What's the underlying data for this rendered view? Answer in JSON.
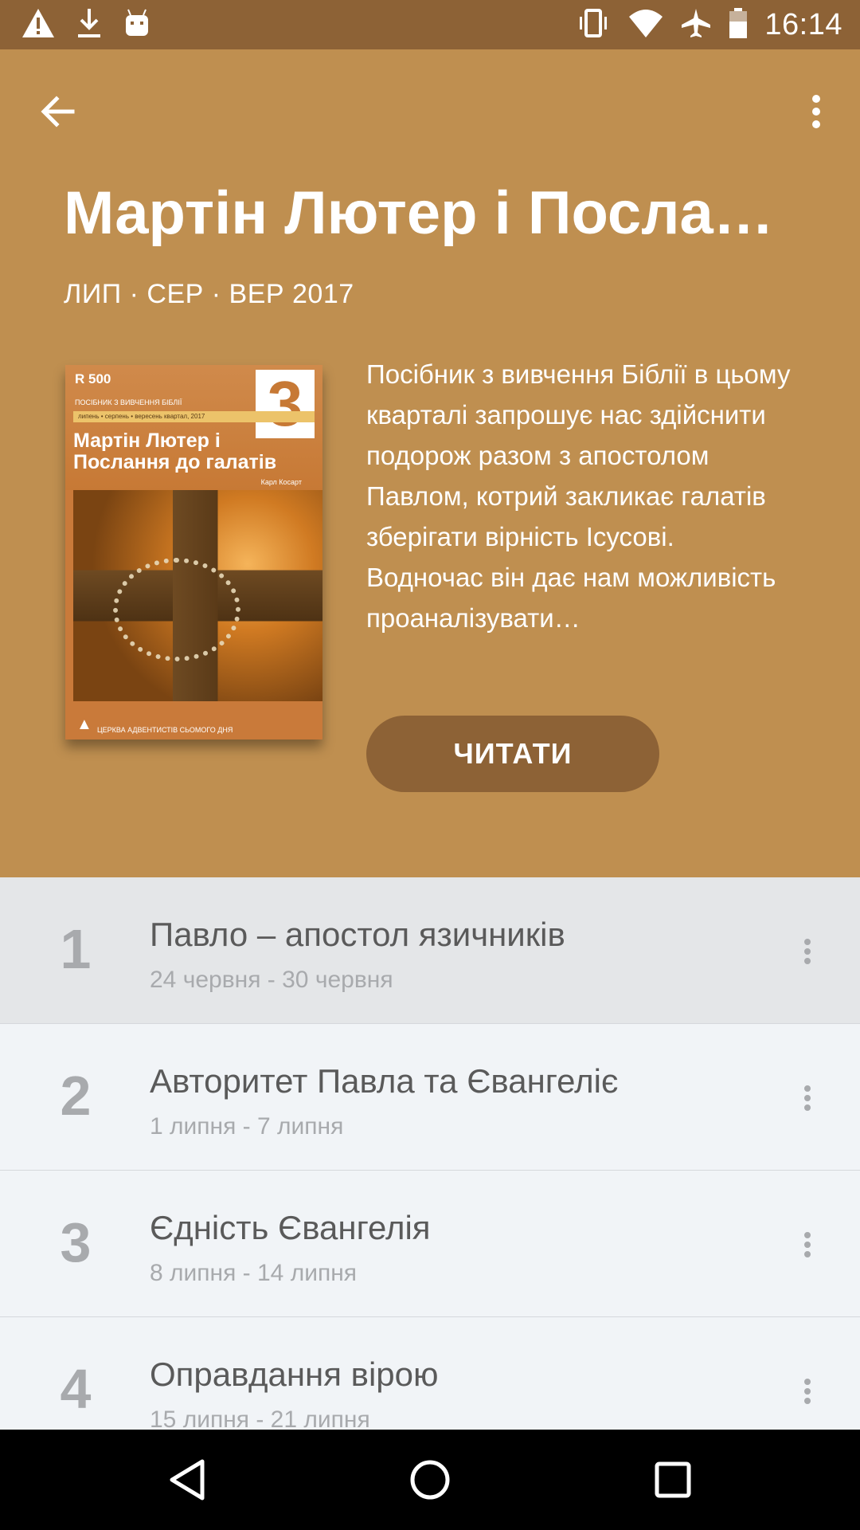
{
  "status_bar": {
    "time": "16:14",
    "left_icons": [
      "warning-icon",
      "download-icon",
      "android-icon"
    ],
    "right_icons": [
      "vibrate-icon",
      "wifi-icon",
      "airplane-icon",
      "battery-icon"
    ]
  },
  "header": {
    "title": "Мартін Лютер і Посла…",
    "subtitle": "ЛИП · СЕР · ВЕР 2017",
    "description": "Посібник з вивчення Біблії в цьому кварталі запрошує нас здійснити подорож разом з апостолом Павлом, котрий закликає галатів зберігати вірність Ісусові. Водночас він дає нам можливість проаналізувати…",
    "read_button": "ЧИТАТИ",
    "background": "#bf8f50",
    "accent": "#8d6236"
  },
  "cover": {
    "logo": "R 500",
    "quarter_digit": "3",
    "series_line": "ПОСІБНИК З ВИВЧЕННЯ БІБЛІЇ",
    "band_text": "липень • серпень • вересень                    квартал, 2017",
    "title": "Мартін Лютер і Послання до галатів",
    "author": "Карл Косарт",
    "footer": "ЦЕРКВА АДВЕНТИСТІВ СЬОМОГО ДНЯ"
  },
  "lessons": [
    {
      "num": "1",
      "title": "Павло – апостол язичників",
      "dates": "24 червня - 30 червня",
      "selected": true
    },
    {
      "num": "2",
      "title": "Авторитет Павла та Євангеліє",
      "dates": "1 липня - 7 липня",
      "selected": false
    },
    {
      "num": "3",
      "title": "Єдність Євангелія",
      "dates": "8 липня - 14 липня",
      "selected": false
    },
    {
      "num": "4",
      "title": "Оправдання вірою",
      "dates": "15 липня - 21 липня",
      "selected": false
    }
  ]
}
